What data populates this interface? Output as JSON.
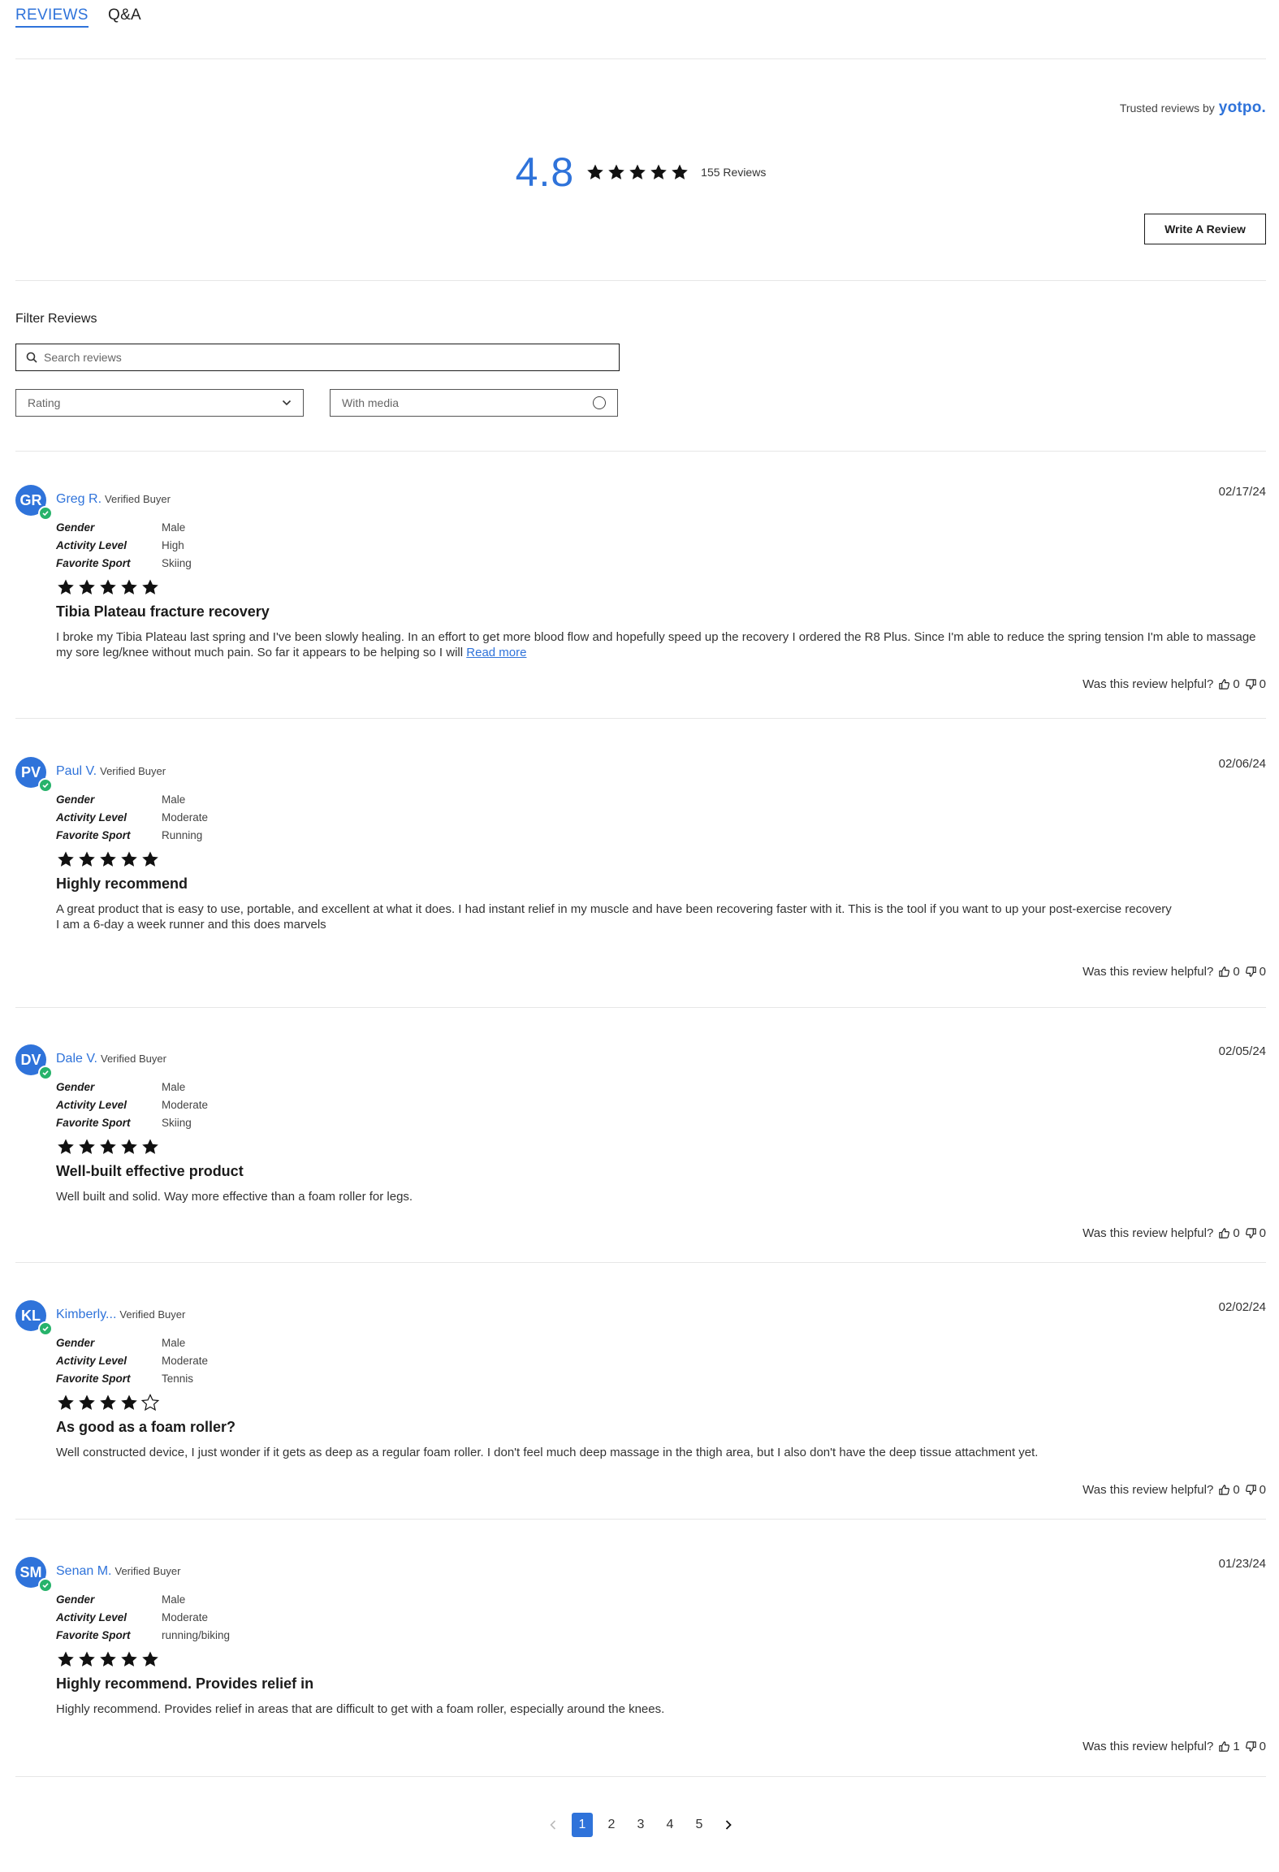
{
  "tabs": {
    "reviews": "REVIEWS",
    "qa": "Q&A"
  },
  "summary": {
    "trusted_prefix": "Trusted reviews by",
    "brand": "yotpo.",
    "average": "4.8",
    "average_stars": 5,
    "count": "155 Reviews",
    "write_button": "Write A Review"
  },
  "filters": {
    "title": "Filter Reviews",
    "search_placeholder": "Search reviews",
    "rating_label": "Rating",
    "media_label": "With media"
  },
  "helpful_label": "Was this review helpful?",
  "attr_labels": {
    "gender": "Gender",
    "activity": "Activity Level",
    "sport": "Favorite Sport"
  },
  "reviews": [
    {
      "initials": "GR",
      "name": "Greg R.",
      "verified": "Verified Buyer",
      "date": "02/17/24",
      "gender": "Male",
      "activity": "High",
      "sport": "Skiing",
      "rating": 5,
      "title": "Tibia Plateau fracture recovery",
      "body": "I broke my Tibia Plateau last spring and I've been slowly healing. In an effort to get more blood flow and hopefully speed up the recovery I ordered the R8 Plus. Since I'm able to reduce the spring tension I'm able to massage my sore leg/knee without much pain. So far it appears to be helping so I will",
      "read_more": "Read more",
      "up": "0",
      "down": "0"
    },
    {
      "initials": "PV",
      "name": "Paul V.",
      "verified": "Verified Buyer",
      "date": "02/06/24",
      "gender": "Male",
      "activity": "Moderate",
      "sport": "Running",
      "rating": 5,
      "title": "Highly recommend",
      "body": "A great product that is easy to use, portable, and excellent at what it does. I had instant relief in my muscle and have been recovering faster with it. This is the tool if you want to up your post-exercise recovery",
      "body2": "I am a 6-day a week runner and this does marvels",
      "up": "0",
      "down": "0"
    },
    {
      "initials": "DV",
      "name": "Dale V.",
      "verified": "Verified Buyer",
      "date": "02/05/24",
      "gender": "Male",
      "activity": "Moderate",
      "sport": "Skiing",
      "rating": 5,
      "title": "Well-built effective product",
      "body": "Well built and solid. Way more effective than a foam roller for legs.",
      "up": "0",
      "down": "0"
    },
    {
      "initials": "KL",
      "name": "Kimberly...",
      "verified": "Verified Buyer",
      "date": "02/02/24",
      "gender": "Male",
      "activity": "Moderate",
      "sport": "Tennis",
      "rating": 4,
      "title": "As good as a foam roller?",
      "body": "Well constructed device, I just wonder if it gets as deep as a regular foam roller. I don't feel much deep massage in the thigh area, but I also don't have the deep tissue attachment yet.",
      "up": "0",
      "down": "0"
    },
    {
      "initials": "SM",
      "name": "Senan M.",
      "verified": "Verified Buyer",
      "date": "01/23/24",
      "gender": "Male",
      "activity": "Moderate",
      "sport": "running/biking",
      "rating": 5,
      "title": "Highly recommend. Provides relief in",
      "body": "Highly recommend. Provides relief in areas that are difficult to get with a foam roller, especially around the knees.",
      "up": "1",
      "down": "0"
    }
  ],
  "pagination": {
    "pages": [
      "1",
      "2",
      "3",
      "4",
      "5"
    ],
    "current": "1"
  },
  "colors": {
    "accent": "#2f73da",
    "verified": "#27b36b"
  }
}
